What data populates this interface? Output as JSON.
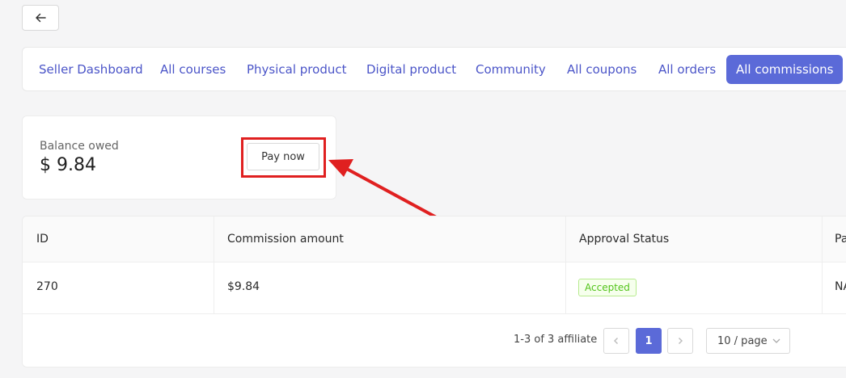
{
  "back": {
    "icon": "arrow-left-icon"
  },
  "tabs": [
    {
      "label": "Seller Dashboard"
    },
    {
      "label": "All courses"
    },
    {
      "label": "Physical product"
    },
    {
      "label": "Digital product"
    },
    {
      "label": "Community"
    },
    {
      "label": "All coupons"
    },
    {
      "label": "All orders"
    },
    {
      "label": "All commissions"
    }
  ],
  "balance": {
    "label": "Balance owed",
    "amount": "$ 9.84",
    "pay_button": "Pay now"
  },
  "table": {
    "headers": [
      "ID",
      "Commission amount",
      "Approval Status",
      "Pa"
    ],
    "rows": [
      {
        "id": "270",
        "amount": "$9.84",
        "status": "Accepted",
        "extra": "NA"
      }
    ]
  },
  "pagination": {
    "info": "1-3 of 3 affiliate",
    "current_page": "1",
    "page_size": "10 / page"
  },
  "colors": {
    "accent": "#5b6ad8",
    "highlight": "#e02020",
    "success": "#52c41a"
  }
}
